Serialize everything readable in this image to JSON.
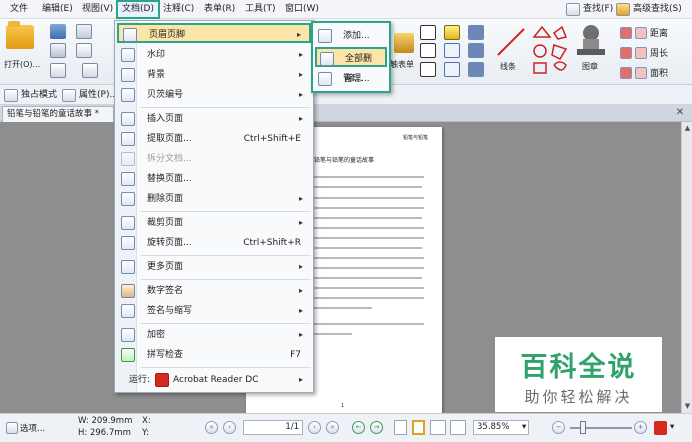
{
  "menubar": {
    "items": [
      "文件",
      "编辑(E)",
      "视图(V)",
      "文档(D)",
      "注释(C)",
      "表单(R)",
      "工具(T)",
      "窗口(W)"
    ],
    "right": [
      "查找(F)",
      "高级查找(S)"
    ]
  },
  "ribbon": {
    "open_label": "打开(O)...",
    "form_label": "触表单",
    "lines_label": "线条",
    "stamp_label": "图章",
    "right_items": [
      "距离",
      "周长",
      "面积"
    ]
  },
  "toolbar2": {
    "standalone_label": "独占模式",
    "properties_label": "属性(P)..."
  },
  "tab": {
    "title": "铅笔与铅笔的童话故事 *"
  },
  "document": {
    "header": "铅笔与铅笔",
    "title": "铅笔与铅笔的童话故事",
    "page_number": "1"
  },
  "watermark": {
    "big": "百科全说",
    "small": "助你轻松解决"
  },
  "menu": {
    "items": [
      {
        "label": "页眉页脚",
        "arrow": "▸"
      },
      {
        "label": "水印",
        "arrow": "▸"
      },
      {
        "label": "背景",
        "arrow": "▸"
      },
      {
        "label": "贝茨编号",
        "arrow": "▸"
      },
      {
        "label": "插入页面",
        "arrow": "▸"
      },
      {
        "label": "提取页面...",
        "shortcut": "Ctrl+Shift+E"
      },
      {
        "label": "拆分文档..."
      },
      {
        "label": "替换页面..."
      },
      {
        "label": "删除页面",
        "arrow": "▸"
      },
      {
        "label": "裁剪页面",
        "arrow": "▸"
      },
      {
        "label": "旋转页面...",
        "shortcut": "Ctrl+Shift+R"
      },
      {
        "label": "更多页面",
        "arrow": "▸"
      },
      {
        "label": "数字签名",
        "arrow": "▸"
      },
      {
        "label": "签名与缩写",
        "arrow": "▸"
      },
      {
        "label": "加密",
        "arrow": "▸"
      },
      {
        "label": "拼写检查",
        "shortcut": "F7"
      },
      {
        "label": "运行:",
        "app": "Acrobat Reader DC",
        "arrow": "▸"
      }
    ]
  },
  "submenu": {
    "items": [
      "添加...",
      "全部删除...",
      "管理..."
    ]
  },
  "statusbar": {
    "options_label": "选项...",
    "width_label": "W: 209.9mm",
    "height_label": "H: 296.7mm",
    "x_label": "X:",
    "y_label": "Y:",
    "page_value": "1/1",
    "zoom_value": "35.85%"
  },
  "colors": {
    "highlight_border": "#2aa58b",
    "menu_hover": "#fbe5a8",
    "watermark_green": "#2fa36b"
  }
}
